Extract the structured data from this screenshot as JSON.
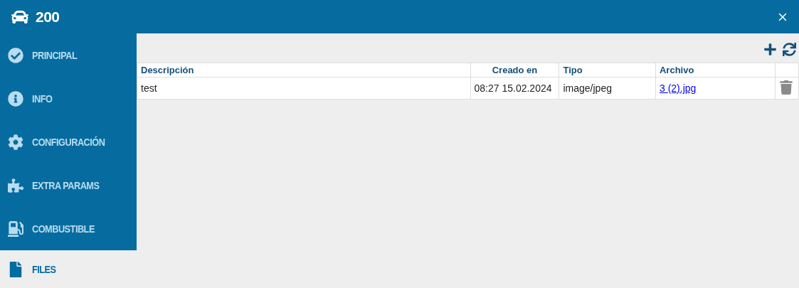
{
  "window": {
    "title": "200"
  },
  "sidebar": {
    "items": [
      {
        "label": "PRINCIPAL",
        "selected": false
      },
      {
        "label": "INFO",
        "selected": false
      },
      {
        "label": "CONFIGURACIÓN",
        "selected": false
      },
      {
        "label": "EXTRA PARAMS",
        "selected": false
      },
      {
        "label": "COMBUSTIBLE",
        "selected": false
      },
      {
        "label": "FILES",
        "selected": true
      }
    ]
  },
  "table": {
    "columns": [
      "Descripción",
      "Creado en",
      "Tipo",
      "Archivo"
    ],
    "rows": [
      {
        "description": "test",
        "created": "08:27 15.02.2024",
        "type": "image/jpeg",
        "file": "3 (2).jpg"
      }
    ]
  }
}
